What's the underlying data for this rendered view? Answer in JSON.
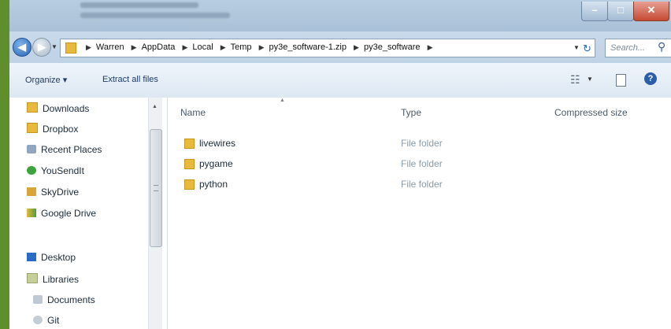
{
  "window": {
    "minimize_label": "–",
    "maximize_label": "□",
    "close_label": "✕"
  },
  "address": {
    "back_label": "◀",
    "forward_label": "▶",
    "breadcrumbs": [
      "Warren",
      "AppData",
      "Local",
      "Temp",
      "py3e_software-1.zip",
      "py3e_software"
    ],
    "search_placeholder": "Search..."
  },
  "toolbar": {
    "organize_label": "Organize ▾",
    "extract_label": "Extract all files",
    "help_label": "?"
  },
  "navpane": {
    "items": [
      {
        "label": "Downloads",
        "icon": "downloads-folder-icon"
      },
      {
        "label": "Dropbox",
        "icon": "dropbox-folder-icon"
      },
      {
        "label": "Recent Places",
        "icon": "recent-places-icon"
      },
      {
        "label": "YouSendIt",
        "icon": "yousendit-icon"
      },
      {
        "label": "SkyDrive",
        "icon": "skydrive-icon"
      },
      {
        "label": "Google Drive",
        "icon": "google-drive-icon"
      },
      {
        "label": "Desktop",
        "icon": "desktop-icon"
      },
      {
        "label": "Libraries",
        "icon": "libraries-icon"
      },
      {
        "label": "Documents",
        "icon": "documents-icon"
      },
      {
        "label": "Git",
        "icon": "git-icon"
      }
    ]
  },
  "content": {
    "columns": [
      "Name",
      "Type",
      "Compressed size"
    ],
    "rows": [
      {
        "name": "livewires",
        "type": "File folder"
      },
      {
        "name": "pygame",
        "type": "File folder"
      },
      {
        "name": "python",
        "type": "File folder"
      }
    ]
  }
}
